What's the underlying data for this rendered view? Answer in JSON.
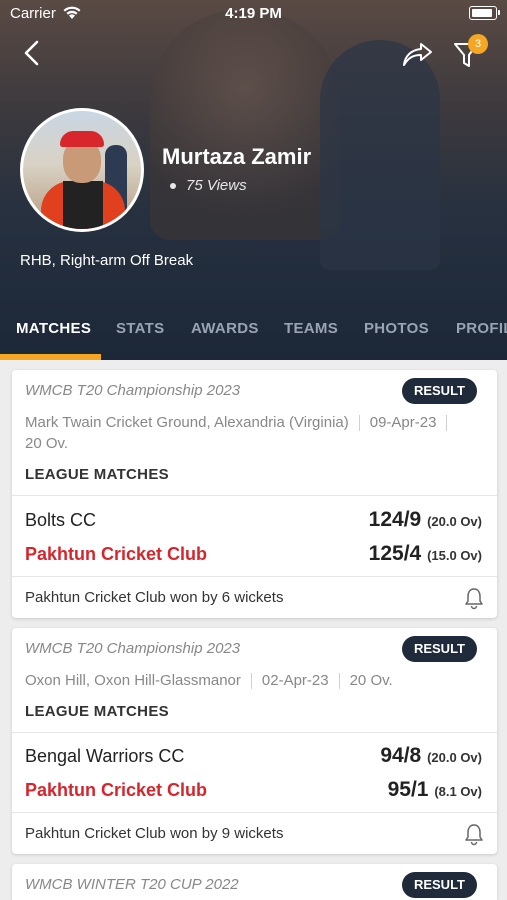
{
  "status_bar": {
    "carrier": "Carrier",
    "time": "4:19 PM"
  },
  "header": {
    "filter_badge": "3",
    "player_name": "Murtaza Zamir",
    "views": "75 Views",
    "role": "RHB, Right-arm Off Break"
  },
  "tabs": [
    "MATCHES",
    "STATS",
    "AWARDS",
    "TEAMS",
    "PHOTOS",
    "PROFILE"
  ],
  "matches": [
    {
      "tournament": "WMCB T20 Championship 2023",
      "badge": "RESULT",
      "venue": "Mark Twain Cricket Ground, Alexandria (Virginia)",
      "date": "09-Apr-23",
      "overs": "20 Ov.",
      "stage": "LEAGUE MATCHES",
      "team1": {
        "name": "Bolts CC",
        "score": "124/9",
        "overs": "(20.0 Ov)"
      },
      "team2": {
        "name": "Pakhtun Cricket Club",
        "score": "125/4",
        "overs": "(15.0 Ov)"
      },
      "result": "Pakhtun Cricket Club won by 6 wickets"
    },
    {
      "tournament": "WMCB T20 Championship 2023",
      "badge": "RESULT",
      "venue": "Oxon Hill, Oxon Hill-Glassmanor",
      "date": "02-Apr-23",
      "overs": "20 Ov.",
      "stage": "LEAGUE MATCHES",
      "team1": {
        "name": "Bengal Warriors CC",
        "score": "94/8",
        "overs": "(20.0 Ov)"
      },
      "team2": {
        "name": "Pakhtun Cricket Club",
        "score": "95/1",
        "overs": "(8.1 Ov)"
      },
      "result": "Pakhtun Cricket Club won by 9 wickets"
    },
    {
      "tournament": "WMCB WINTER T20 CUP 2022",
      "badge": "RESULT"
    }
  ],
  "colors": {
    "accent": "#f5a623",
    "winner": "#d6262d",
    "badge_bg": "#1f2a3a"
  }
}
